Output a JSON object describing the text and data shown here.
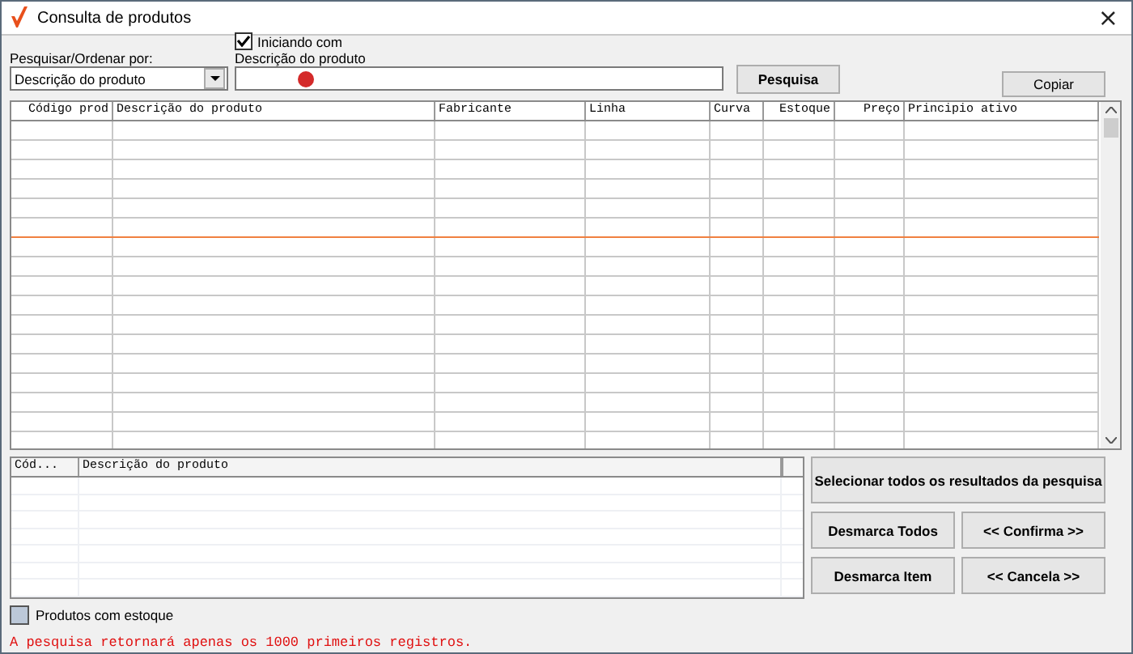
{
  "window": {
    "title": "Consulta de produtos",
    "close": "×"
  },
  "search": {
    "order_label": "Pesquisar/Ordenar por:",
    "order_value": "Descrição do produto",
    "starts_with": {
      "label": "Iniciando com",
      "checked": true
    },
    "field_label": "Descrição do produto",
    "search_button": "Pesquisa"
  },
  "copy_button": "Copiar",
  "results_table": {
    "columns": [
      "Código prod",
      "Descrição do produto",
      "Fabricante",
      "Linha",
      "Curva",
      "Estoque",
      "Preço",
      "Principio ativo"
    ]
  },
  "selection_table": {
    "columns": [
      "Cód...",
      "Descrição do produto"
    ]
  },
  "buttons": [
    "Selecionar todos os resultados da pesquisa",
    "Desmarca Todos",
    "<< Confirma >>",
    "Desmarca Item",
    "<< Cancela >>"
  ],
  "legend": {
    "label": "Produtos com estoque"
  },
  "notice": "A pesquisa retornará apenas os 1000 primeiros registros."
}
